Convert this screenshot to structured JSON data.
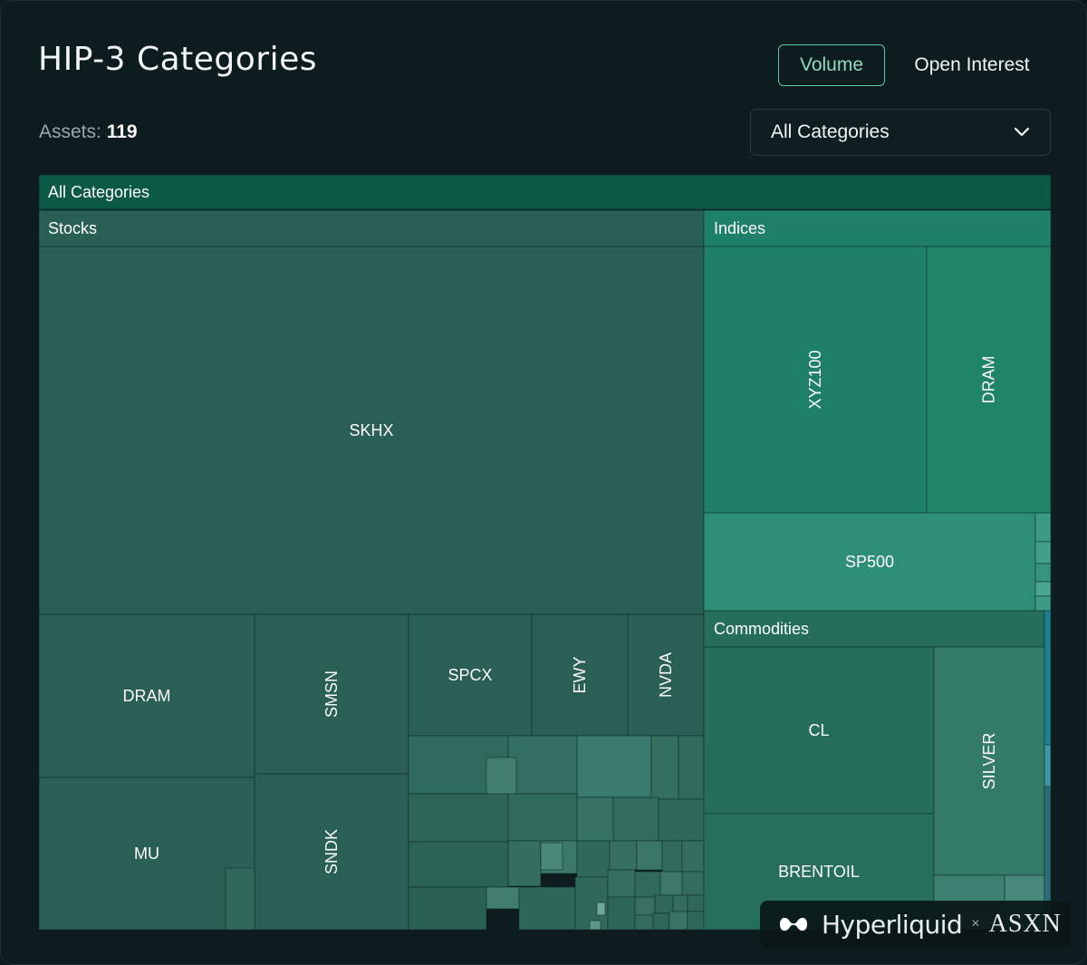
{
  "header": {
    "title": "HIP-3 Categories",
    "tab_volume": "Volume",
    "tab_open_interest": "Open Interest",
    "assets_label": "Assets:",
    "assets_count": "119",
    "category_select": "All Categories"
  },
  "watermark": {
    "left": "Hyperliquid",
    "sep": "×",
    "right": "ASXN"
  },
  "colors": {
    "background": "#0d1c1f",
    "accent": "#5cc8a2",
    "root_header": "#0c5a45",
    "stocks": "#2a5f55",
    "indices": "#1e8068",
    "indices_sp500": "#2e8f78",
    "commodities": "#256e5c"
  },
  "chart_data": {
    "type": "treemap",
    "metric": "Volume",
    "root": "All Categories",
    "groups": [
      {
        "name": "Stocks",
        "items": [
          {
            "name": "SKHX",
            "value": 1000
          },
          {
            "name": "DRAM",
            "value": 145
          },
          {
            "name": "MU",
            "value": 115
          },
          {
            "name": "SMSN",
            "value": 95
          },
          {
            "name": "SNDK",
            "value": 80
          },
          {
            "name": "SPCX",
            "value": 55
          },
          {
            "name": "EWY",
            "value": 43
          },
          {
            "name": "NVDA",
            "value": 35
          },
          {
            "name": "",
            "value": 230
          }
        ]
      },
      {
        "name": "Indices",
        "items": [
          {
            "name": "XYZ100",
            "value": 230
          },
          {
            "name": "DRAM",
            "value": 125
          },
          {
            "name": "SP500",
            "value": 60
          },
          {
            "name": "",
            "value": 12
          }
        ]
      },
      {
        "name": "Commodities",
        "items": [
          {
            "name": "CL",
            "value": 150
          },
          {
            "name": "BRENTOIL",
            "value": 100
          },
          {
            "name": "SILVER",
            "value": 100
          },
          {
            "name": "",
            "value": 12
          }
        ]
      }
    ]
  }
}
